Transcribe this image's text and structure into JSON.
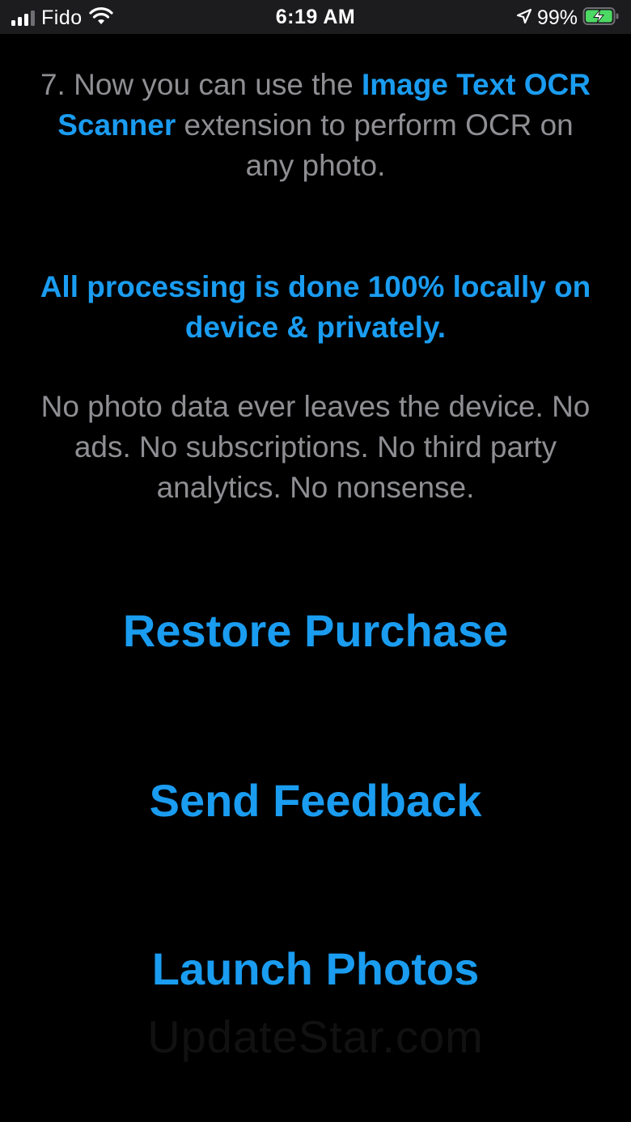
{
  "status_bar": {
    "carrier": "Fido",
    "time": "6:19 AM",
    "battery_percent": "99%",
    "signal_bars_active": 3,
    "signal_bars_total": 4,
    "battery_level": 0.99,
    "icons": [
      "signal-icon",
      "wifi-icon",
      "location-icon",
      "battery-charging-icon"
    ]
  },
  "step": {
    "prefix": "7. Now you can use the ",
    "app_name": "Image Text OCR Scanner",
    "suffix": "  extension to perform OCR on any photo."
  },
  "privacy": {
    "heading": "All processing is done 100% locally on device & privately.",
    "body": "No photo data ever leaves the device. No ads. No subscriptions. No third party analytics. No nonsense."
  },
  "actions": {
    "restore_purchase": "Restore Purchase",
    "send_feedback": "Send Feedback",
    "launch_photos": "Launch Photos"
  },
  "watermark": "UpdateStar.com",
  "colors": {
    "accent": "#1a9cf0",
    "body_text": "#8e8e93",
    "background": "#000000",
    "battery_green": "#4cd964"
  }
}
